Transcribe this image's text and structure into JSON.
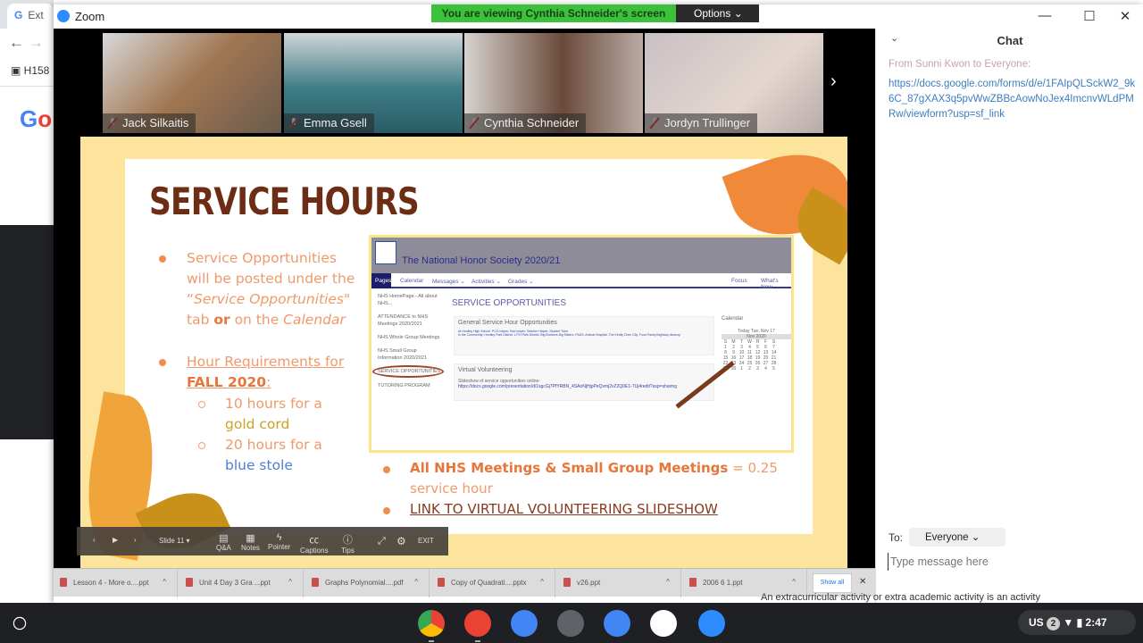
{
  "browser": {
    "tab_label": "Ext",
    "bookmark": "H158",
    "logo_text": "Go"
  },
  "zoom": {
    "title": "Zoom",
    "banner": "You are viewing Cynthia Schneider's screen",
    "options_label": "Options",
    "participants": [
      {
        "name": "Jack Silkaitis",
        "bg": "#8a7a6c"
      },
      {
        "name": "Emma Gsell",
        "bg": "#3f7d86"
      },
      {
        "name": "Cynthia Schneider",
        "bg": "#9a8f86"
      },
      {
        "name": "Jordyn Trullinger",
        "bg": "#c9c0c4"
      }
    ]
  },
  "slide": {
    "title": "SERVICE HOURS",
    "bullet1": {
      "a": "Service Opportunities will be posted under the “",
      "b": "Service Opportunities",
      "c": "\" tab ",
      "d": "or",
      "e": " on the ",
      "f": "Calendar"
    },
    "bullet2": {
      "a": "Hour Requirements for ",
      "b": "FALL 2020",
      "c": ":"
    },
    "sub1": {
      "a": "10 hours for a ",
      "b": "gold cord"
    },
    "sub2": {
      "a": "20 hours for a ",
      "b": "blue stole"
    },
    "bullet3": {
      "a": "All NHS Meetings & Small Group Meetings",
      "b": " = 0.25 service hour"
    },
    "bullet4": "LINK TO VIRTUAL VOLUNTEERING SLIDESHOW",
    "screenshot": {
      "site_title": "The National Honor Society 2020/21",
      "nav": [
        "Pages",
        "Calendar",
        "Messages ⌄",
        "Activities ⌄",
        "Grades ⌄",
        "Focus",
        "What's New"
      ],
      "side": [
        "NHS HomePage - All about NHS...",
        "ATTENDANCE to NHS Meetings 2020/2021",
        "NHS Whole Group Meetings",
        "NHS Small Group Information 2020/2021",
        "SERVICE OPPORTUNITIES",
        "TUTORING PROGRAM"
      ],
      "heading": "SERVICE OPPORTUNITIES",
      "box1_title": "General Service Hour Opportunities",
      "box1_line1": "At Huntley High School: PCO helper, Hub helper, Teacher Helper, Student Tutor",
      "box1_line2": "In the Community: Huntley Park District, LITH Park District, Big Brothers Big Sisters, PADS, Animal Hospital, The Kindly Clem City, Food Pantry/highway cleanup",
      "box2_title": "Virtual Volunteering",
      "box2_line1": "Slideshow of service opportunities online-",
      "box2_link": "https://docs.google.com/presentation/d/1sgcGj7PfYRBN_4SAoNjHjpPeQvmj2vZ2Q0E1-7Uj4redit?usp=sharing",
      "cal_title": "Calendar",
      "cal_today": "Today Tue, Nov 17",
      "cal_month": "Nov 2020",
      "cal_days": [
        "S",
        "M",
        "T",
        "W",
        "R",
        "F",
        "S"
      ],
      "cal_rows": [
        [
          "1",
          "2",
          "3",
          "4",
          "5",
          "6",
          "7"
        ],
        [
          "8",
          "9",
          "10",
          "11",
          "12",
          "13",
          "14"
        ],
        [
          "15",
          "16",
          "17",
          "18",
          "19",
          "20",
          "21"
        ],
        [
          "22",
          "23",
          "24",
          "25",
          "26",
          "27",
          "28"
        ],
        [
          "29",
          "30",
          "1",
          "2",
          "3",
          "4",
          "5"
        ]
      ]
    }
  },
  "ppt_toolbar": {
    "slide": "Slide 11",
    "qa": "Q&A",
    "notes": "Notes",
    "pointer": "Pointer",
    "captions": "Captions",
    "tips": "Tips",
    "exit": "EXIT"
  },
  "downloads": {
    "items": [
      "Lesson 4 - More o....ppt",
      "Unit 4 Day 3 Gra ...ppt",
      "Graphs Polynomial....pdf",
      "Copy of Quadrati....pptx",
      "v26.ppt",
      "2006 6 1.ppt"
    ],
    "show_all": "Show all"
  },
  "chat": {
    "title": "Chat",
    "from": "From Sunni Kwon to Everyone:",
    "message": "https://docs.google.com/forms/d/e/1FAIpQLSckW2_9k6C_87gXAX3q5pvWwZBBcAowNoJex4ImcnvWLdPMRw/viewform?usp=sf_link",
    "to_label": "To:",
    "to_value": "Everyone",
    "placeholder": "Type message here"
  },
  "behind_text": "An extracurricular activity or extra academic activity is an activity",
  "shelf": {
    "apps": [
      {
        "name": "chrome",
        "color": "#e94235"
      },
      {
        "name": "gmail",
        "color": "#ea4335"
      },
      {
        "name": "docs",
        "color": "#4285f4"
      },
      {
        "name": "camera",
        "color": "#5f6368"
      },
      {
        "name": "files",
        "color": "#4285f4"
      },
      {
        "name": "play-store",
        "color": "#ffffff"
      },
      {
        "name": "zoom",
        "color": "#2d8cff"
      }
    ],
    "locale": "US",
    "notif_count": "2",
    "time": "2:47"
  }
}
